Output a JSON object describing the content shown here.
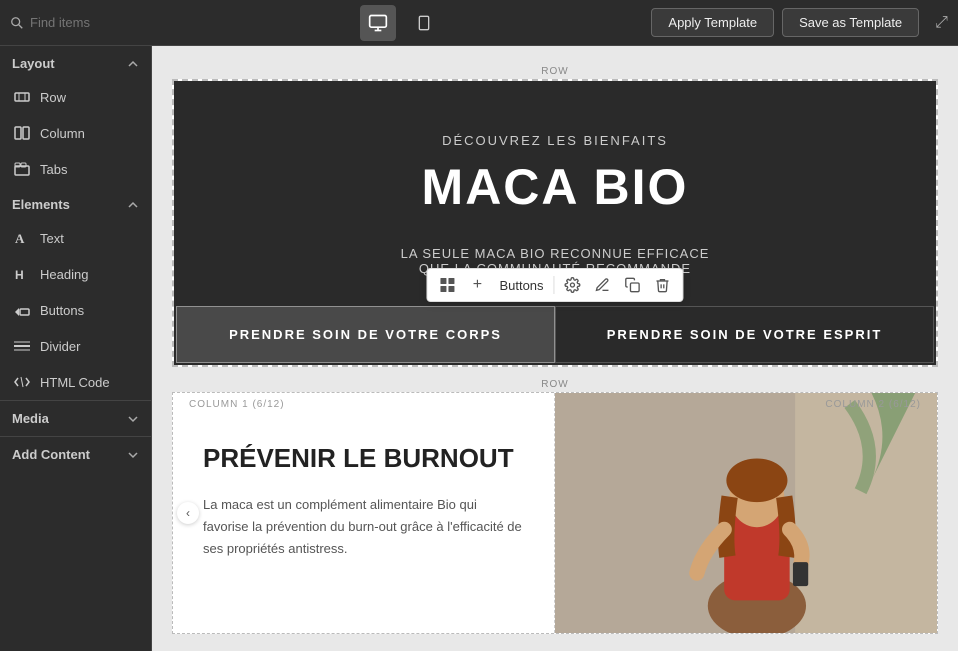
{
  "topbar": {
    "search_placeholder": "Find items",
    "apply_template_label": "Apply Template",
    "save_template_label": "Save as Template",
    "device_desktop_label": "Desktop view",
    "device_mobile_label": "Mobile view"
  },
  "sidebar": {
    "layout_section_label": "Layout",
    "row_label": "Row",
    "column_label": "Column",
    "tabs_label": "Tabs",
    "elements_section_label": "Elements",
    "text_label": "Text",
    "heading_label": "Heading",
    "buttons_label": "Buttons",
    "divider_label": "Divider",
    "html_code_label": "HTML Code",
    "media_section_label": "Media",
    "add_content_label": "Add Content"
  },
  "canvas": {
    "row_label": "ROW",
    "second_row_label": "ROW",
    "column1_label": "COLUMN 1 (6/12)",
    "column2_label": "COLUMN 2 (6/12)"
  },
  "hero": {
    "subtitle": "DÉCOUVREZ LES BIENFAITS",
    "title": "MACA BIO",
    "description_line1": "LA SEULE MACA BIO RECONNUE EFFICACE",
    "description_line2": "QUE LA COMMUNAUTÉ RECOMMANDE",
    "btn1_label": "PRENDRE SOIN DE VOTRE CORPS",
    "btn2_label": "PRENDRE SOIN DE VOTRE ESPRIT"
  },
  "toolbar": {
    "element_label": "Buttons",
    "grid_icon": "⊞",
    "plus_icon": "+",
    "settings_icon": "⚙",
    "style_icon": "✏",
    "copy_icon": "⧉",
    "delete_icon": "🗑"
  },
  "content_section": {
    "title": "PRÉVENIR LE BURNOUT",
    "text": "La maca est un complément alimentaire Bio qui favorise la prévention du burn-out grâce à l'efficacité de ses propriétés antistress."
  }
}
